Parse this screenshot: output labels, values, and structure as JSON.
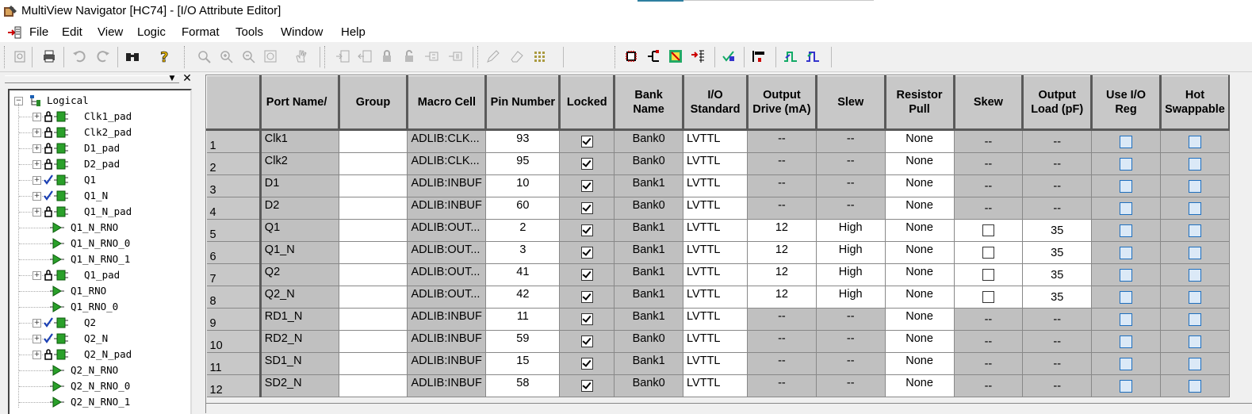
{
  "window": {
    "title": "MultiView Navigator [HC74] - [I/O Attribute Editor]"
  },
  "menu": [
    "File",
    "Edit",
    "View",
    "Logic",
    "Format",
    "Tools",
    "Window",
    "Help"
  ],
  "toolbar_icons": [
    "new-icon",
    "print-icon",
    "undo-icon",
    "redo-icon",
    "find-icon",
    "help-icon",
    "zoom-region-icon",
    "zoom-in-icon",
    "zoom-out-icon",
    "zoom-fit-icon",
    "pan-hand-icon",
    "add-port-icon",
    "add-net-icon",
    "lock-icon",
    "unlock-icon",
    "bus-icon",
    "bus2-icon",
    "pencil-icon",
    "eraser-icon",
    "grid-icon",
    "chip-icon",
    "split-icon",
    "package-view-icon",
    "net-list-icon",
    "checker-icon",
    "align-icon",
    "waveform-icon",
    "waveform2-icon"
  ],
  "tree": {
    "root": "Logical",
    "items": [
      {
        "label": "Clk1_pad",
        "icon": "lock-port",
        "expandable": true
      },
      {
        "label": "Clk2_pad",
        "icon": "lock-port",
        "expandable": true
      },
      {
        "label": "D1_pad",
        "icon": "lock-port",
        "expandable": true
      },
      {
        "label": "D2_pad",
        "icon": "lock-port",
        "expandable": true
      },
      {
        "label": "Q1",
        "icon": "check-port",
        "expandable": true
      },
      {
        "label": "Q1_N",
        "icon": "check-port",
        "expandable": true
      },
      {
        "label": "Q1_N_pad",
        "icon": "lock-port",
        "expandable": true
      },
      {
        "label": "Q1_N_RNO",
        "icon": "buffer",
        "expandable": false
      },
      {
        "label": "Q1_N_RNO_0",
        "icon": "buffer",
        "expandable": false
      },
      {
        "label": "Q1_N_RNO_1",
        "icon": "buffer",
        "expandable": false
      },
      {
        "label": "Q1_pad",
        "icon": "lock-port",
        "expandable": true
      },
      {
        "label": "Q1_RNO",
        "icon": "buffer",
        "expandable": false
      },
      {
        "label": "Q1_RNO_0",
        "icon": "buffer",
        "expandable": false
      },
      {
        "label": "Q2",
        "icon": "check-port",
        "expandable": true
      },
      {
        "label": "Q2_N",
        "icon": "check-port",
        "expandable": true
      },
      {
        "label": "Q2_N_pad",
        "icon": "lock-port",
        "expandable": true
      },
      {
        "label": "Q2_N_RNO",
        "icon": "buffer",
        "expandable": false
      },
      {
        "label": "Q2_N_RNO_0",
        "icon": "buffer",
        "expandable": false
      },
      {
        "label": "Q2_N_RNO_1",
        "icon": "buffer",
        "expandable": false
      }
    ]
  },
  "grid": {
    "headers": [
      "Port Name/",
      "Group",
      "Macro Cell",
      "Pin Number",
      "Locked",
      "Bank\nName",
      "I/O\nStandard",
      "Output\nDrive (mA)",
      "Slew",
      "Resistor\nPull",
      "Skew",
      "Output\nLoad (pF)",
      "Use I/O\nReg",
      "Hot\nSwappable"
    ],
    "rows": [
      {
        "n": "1",
        "port": "Clk1",
        "group": "",
        "macro": "ADLIB:CLK...",
        "pin": "93",
        "locked": true,
        "bank": "Bank0",
        "std": "LVTTL",
        "drive": "--",
        "slew": "--",
        "pull": "None",
        "skew": "--",
        "load": "--",
        "editable_out": false
      },
      {
        "n": "2",
        "port": "Clk2",
        "group": "",
        "macro": "ADLIB:CLK...",
        "pin": "95",
        "locked": true,
        "bank": "Bank0",
        "std": "LVTTL",
        "drive": "--",
        "slew": "--",
        "pull": "None",
        "skew": "--",
        "load": "--",
        "editable_out": false
      },
      {
        "n": "3",
        "port": "D1",
        "group": "",
        "macro": "ADLIB:INBUF",
        "pin": "10",
        "locked": true,
        "bank": "Bank1",
        "std": "LVTTL",
        "drive": "--",
        "slew": "--",
        "pull": "None",
        "skew": "--",
        "load": "--",
        "editable_out": false
      },
      {
        "n": "4",
        "port": "D2",
        "group": "",
        "macro": "ADLIB:INBUF",
        "pin": "60",
        "locked": true,
        "bank": "Bank0",
        "std": "LVTTL",
        "drive": "--",
        "slew": "--",
        "pull": "None",
        "skew": "--",
        "load": "--",
        "editable_out": false
      },
      {
        "n": "5",
        "port": "Q1",
        "group": "",
        "macro": "ADLIB:OUT...",
        "pin": "2",
        "locked": true,
        "bank": "Bank1",
        "std": "LVTTL",
        "drive": "12",
        "slew": "High",
        "pull": "None",
        "skew": "",
        "load": "35",
        "editable_out": true
      },
      {
        "n": "6",
        "port": "Q1_N",
        "group": "",
        "macro": "ADLIB:OUT...",
        "pin": "3",
        "locked": true,
        "bank": "Bank1",
        "std": "LVTTL",
        "drive": "12",
        "slew": "High",
        "pull": "None",
        "skew": "",
        "load": "35",
        "editable_out": true
      },
      {
        "n": "7",
        "port": "Q2",
        "group": "",
        "macro": "ADLIB:OUT...",
        "pin": "41",
        "locked": true,
        "bank": "Bank1",
        "std": "LVTTL",
        "drive": "12",
        "slew": "High",
        "pull": "None",
        "skew": "",
        "load": "35",
        "editable_out": true
      },
      {
        "n": "8",
        "port": "Q2_N",
        "group": "",
        "macro": "ADLIB:OUT...",
        "pin": "42",
        "locked": true,
        "bank": "Bank1",
        "std": "LVTTL",
        "drive": "12",
        "slew": "High",
        "pull": "None",
        "skew": "",
        "load": "35",
        "editable_out": true
      },
      {
        "n": "9",
        "port": "RD1_N",
        "group": "",
        "macro": "ADLIB:INBUF",
        "pin": "11",
        "locked": true,
        "bank": "Bank1",
        "std": "LVTTL",
        "drive": "--",
        "slew": "--",
        "pull": "None",
        "skew": "--",
        "load": "--",
        "editable_out": false
      },
      {
        "n": "10",
        "port": "RD2_N",
        "group": "",
        "macro": "ADLIB:INBUF",
        "pin": "59",
        "locked": true,
        "bank": "Bank0",
        "std": "LVTTL",
        "drive": "--",
        "slew": "--",
        "pull": "None",
        "skew": "--",
        "load": "--",
        "editable_out": false
      },
      {
        "n": "11",
        "port": "SD1_N",
        "group": "",
        "macro": "ADLIB:INBUF",
        "pin": "15",
        "locked": true,
        "bank": "Bank1",
        "std": "LVTTL",
        "drive": "--",
        "slew": "--",
        "pull": "None",
        "skew": "--",
        "load": "--",
        "editable_out": false
      },
      {
        "n": "12",
        "port": "SD2_N",
        "group": "",
        "macro": "ADLIB:INBUF",
        "pin": "58",
        "locked": true,
        "bank": "Bank0",
        "std": "LVTTL",
        "drive": "--",
        "slew": "--",
        "pull": "None",
        "skew": "--",
        "load": "--",
        "editable_out": false
      }
    ]
  },
  "colors": {
    "accent": "#2e7fa0",
    "cell_gray": "#c0c0c0",
    "header_gray": "#c8c8c8",
    "checkbox_blue": "#1e6fbf"
  }
}
